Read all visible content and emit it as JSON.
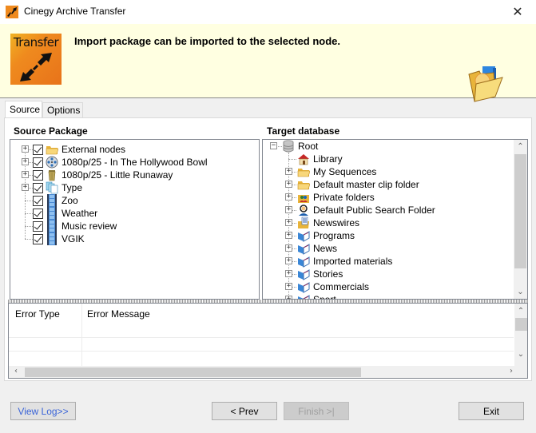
{
  "window": {
    "title": "Cinegy Archive Transfer",
    "close_icon": "close-x-icon"
  },
  "banner": {
    "logo_text": "Transfer",
    "message": "Import package can be imported to the selected node.",
    "art_icon": "open-folder-icon"
  },
  "tabs": [
    {
      "label": "Source",
      "active": true
    },
    {
      "label": "Options",
      "active": false
    }
  ],
  "source_package": {
    "label": "Source Package",
    "items": [
      {
        "label": "External nodes",
        "icon": "folder-icon",
        "checked": true,
        "expandable": true
      },
      {
        "label": "1080p/25 - In The Hollywood Bowl",
        "icon": "film-reel-icon",
        "checked": true,
        "expandable": true
      },
      {
        "label": "1080p/25 - Little Runaway",
        "icon": "bin-icon",
        "checked": true,
        "expandable": true
      },
      {
        "label": "Type",
        "icon": "documents-icon",
        "checked": true,
        "expandable": true
      },
      {
        "label": "Zoo",
        "icon": "film-strip-icon",
        "checked": true,
        "expandable": false
      },
      {
        "label": "Weather",
        "icon": "film-strip-icon",
        "checked": true,
        "expandable": false
      },
      {
        "label": "Music review",
        "icon": "film-strip-icon",
        "checked": true,
        "expandable": false
      },
      {
        "label": "VGIK",
        "icon": "film-strip-icon",
        "checked": true,
        "expandable": false
      }
    ]
  },
  "target_database": {
    "label": "Target database",
    "root": {
      "label": "Root",
      "icon": "database-icon",
      "expanded": true
    },
    "items": [
      {
        "label": "Library",
        "icon": "house-icon",
        "expandable": false
      },
      {
        "label": "My Sequences",
        "icon": "folder-icon",
        "expandable": true
      },
      {
        "label": "Default master clip folder",
        "icon": "folder-icon",
        "expandable": true
      },
      {
        "label": "Private folders",
        "icon": "users-folder-icon",
        "expandable": true
      },
      {
        "label": "Default Public Search Folder",
        "icon": "search-user-icon",
        "expandable": true
      },
      {
        "label": "Newswires",
        "icon": "news-folder-icon",
        "expandable": true
      },
      {
        "label": "Programs",
        "icon": "open-book-icon",
        "expandable": true
      },
      {
        "label": "News",
        "icon": "open-book-icon",
        "expandable": true
      },
      {
        "label": "Imported materials",
        "icon": "open-book-icon",
        "expandable": true
      },
      {
        "label": "Stories",
        "icon": "open-book-icon",
        "expandable": true
      },
      {
        "label": "Commercials",
        "icon": "open-book-icon",
        "expandable": true
      },
      {
        "label": "Sport",
        "icon": "open-book-icon",
        "expandable": true
      }
    ]
  },
  "error_grid": {
    "columns": [
      "Error Type",
      "Error Message"
    ],
    "rows": []
  },
  "buttons": {
    "view_log": "View Log>>",
    "prev": "< Prev",
    "finish": "Finish >|",
    "exit": "Exit"
  },
  "colors": {
    "banner_bg": "#ffffe1",
    "logo_orange": "#e8731a",
    "link_blue": "#3a64d8"
  }
}
